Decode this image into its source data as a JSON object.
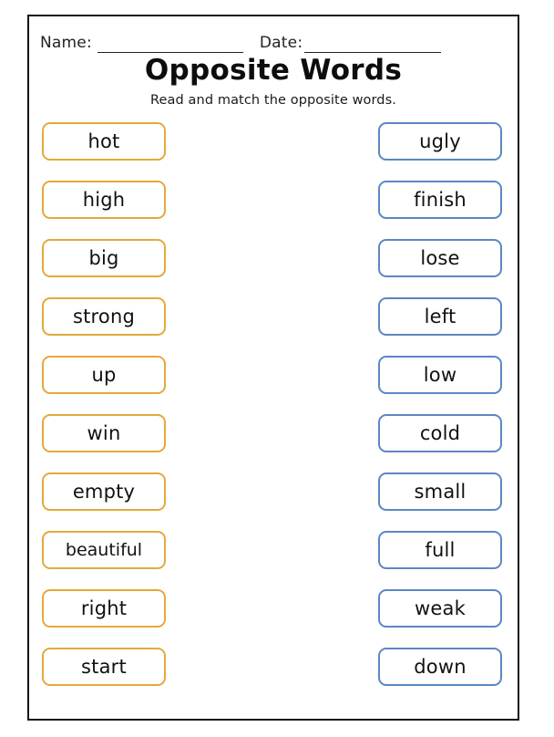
{
  "worksheet": {
    "title": "Opposite Words",
    "subtitle": "Read and match the opposite words.",
    "name_label": "Name:",
    "date_label": "Date:",
    "left_column": [
      {
        "word": "hot"
      },
      {
        "word": "high"
      },
      {
        "word": "big"
      },
      {
        "word": "strong"
      },
      {
        "word": "up"
      },
      {
        "word": "win"
      },
      {
        "word": "empty"
      },
      {
        "word": "beautiful"
      },
      {
        "word": "right"
      },
      {
        "word": "start"
      }
    ],
    "right_column": [
      {
        "word": "ugly"
      },
      {
        "word": "finish"
      },
      {
        "word": "lose"
      },
      {
        "word": "left"
      },
      {
        "word": "low"
      },
      {
        "word": "cold"
      },
      {
        "word": "small"
      },
      {
        "word": "full"
      },
      {
        "word": "weak"
      },
      {
        "word": "down"
      }
    ],
    "colors": {
      "left_border": "#e4a93c",
      "right_border": "#5b87c4",
      "page_border": "#141414",
      "text": "#111111"
    }
  }
}
